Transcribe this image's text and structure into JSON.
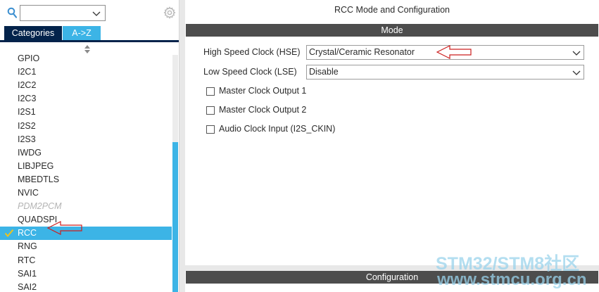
{
  "left_panel": {
    "tabs": [
      {
        "label": "Categories"
      },
      {
        "label": "A->Z"
      }
    ],
    "peripherals": [
      {
        "label": "GPIO",
        "state": "normal"
      },
      {
        "label": "I2C1",
        "state": "normal"
      },
      {
        "label": "I2C2",
        "state": "normal"
      },
      {
        "label": "I2C3",
        "state": "normal"
      },
      {
        "label": "I2S1",
        "state": "normal"
      },
      {
        "label": "I2S2",
        "state": "normal"
      },
      {
        "label": "I2S3",
        "state": "normal"
      },
      {
        "label": "IWDG",
        "state": "normal"
      },
      {
        "label": "LIBJPEG",
        "state": "normal"
      },
      {
        "label": "MBEDTLS",
        "state": "normal"
      },
      {
        "label": "NVIC",
        "state": "normal"
      },
      {
        "label": "PDM2PCM",
        "state": "disabled"
      },
      {
        "label": "QUADSPI",
        "state": "normal"
      },
      {
        "label": "RCC",
        "state": "selected"
      },
      {
        "label": "RNG",
        "state": "normal"
      },
      {
        "label": "RTC",
        "state": "normal"
      },
      {
        "label": "SAI1",
        "state": "normal"
      },
      {
        "label": "SAI2",
        "state": "normal"
      }
    ]
  },
  "right_panel": {
    "title": "RCC Mode and Configuration",
    "mode_header": "Mode",
    "config_header": "Configuration",
    "hse": {
      "label": "High Speed Clock (HSE)",
      "value": "Crystal/Ceramic Resonator"
    },
    "lse": {
      "label": "Low Speed Clock (LSE)",
      "value": "Disable"
    },
    "checkboxes": [
      {
        "label": "Master Clock Output 1",
        "checked": false
      },
      {
        "label": "Master Clock Output 2",
        "checked": false
      },
      {
        "label": "Audio Clock Input (I2S_CKIN)",
        "checked": false
      }
    ]
  },
  "watermark": {
    "line1": "STM32/STM8社区",
    "line2": "www.stmcu.org.cn"
  },
  "colors": {
    "accent": "#3cb4e6",
    "dark_tab": "#03234b",
    "section_bar": "#4d4d4d",
    "check": "#f0c419",
    "hint_arrow": "#cc1f1f"
  },
  "icons": {
    "search": "search-icon",
    "gear": "gear-icon",
    "chevron": "chevron-down-icon",
    "check": "check-icon",
    "sort": "sort-icon"
  }
}
